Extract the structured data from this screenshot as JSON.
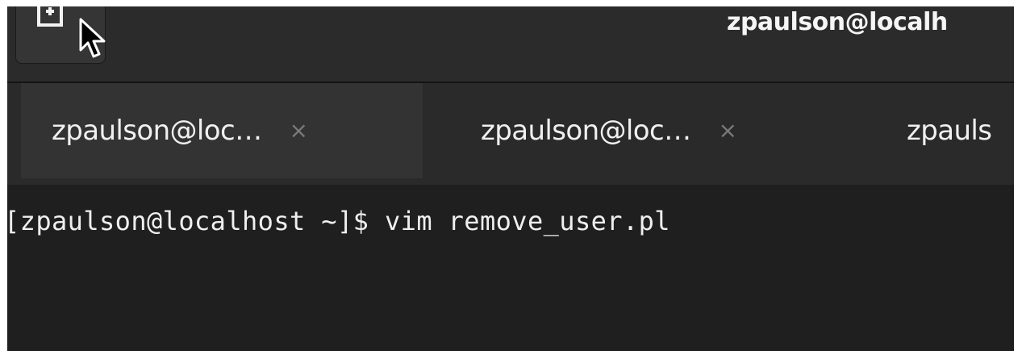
{
  "header": {
    "window_title": "zpaulson@localh",
    "new_tab_icon": "new-tab-icon",
    "cursor_icon": "mouse-pointer-icon"
  },
  "tabs": [
    {
      "label": "zpaulson@loc…",
      "close": "×",
      "active": true
    },
    {
      "label": "zpaulson@loc…",
      "close": "×",
      "active": false
    },
    {
      "label": "zpauls",
      "close": "",
      "active": false
    }
  ],
  "terminal": {
    "prompt": "[zpaulson@localhost ~]$ ",
    "command": "vim remove_user.pl"
  },
  "colors": {
    "background": "#1f1f1f",
    "headerbar": "#2b2b2b",
    "active_tab": "#333333",
    "text": "#f0f0f0",
    "close_icon": "#7a7a7a"
  }
}
